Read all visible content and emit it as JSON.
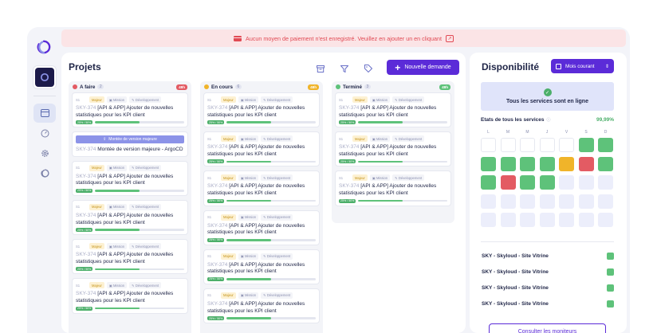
{
  "alert": {
    "text": "Aucun moyen de paiement n'est enregistré. Veuillez en ajouter un en cliquant"
  },
  "projects": {
    "title": "Projets",
    "new_button": "Nouvelle demande",
    "columns": [
      {
        "name": "A faire",
        "count": "2",
        "tag": "48h",
        "tag_color": "#e35b63",
        "icon_color": "#e35b63"
      },
      {
        "name": "En cours",
        "count": "6",
        "tag": "48h",
        "tag_color": "#f0b42a",
        "icon_color": "#f0b42a"
      },
      {
        "name": "Terminé",
        "count": "3",
        "tag": "48h",
        "tag_color": "#5ec27a",
        "icon_color": "#5ec27a"
      }
    ],
    "card": {
      "priority": "S1",
      "chip_major": "Majeur",
      "chip_mission": "Mission",
      "chip_dev": "Développement",
      "ref": "SKY-374",
      "title": "[API & APP] Ajouter de nouvelles statistiques pour les KPI client",
      "progress_label": "25% / 50%",
      "progress": 0.5
    },
    "version_card": {
      "button": "Montée de version majeure",
      "ref": "SKY-374",
      "title": "Montée de version majeure - ArgoCD"
    }
  },
  "availability": {
    "title": "Disponibilité",
    "month_button": "Mois courant",
    "status": "Tous les services sont en ligne",
    "states_label": "Etats de tous les services",
    "uptime": "99,99%",
    "days": [
      "L",
      "M",
      "M",
      "J",
      "V",
      "S",
      "D"
    ],
    "calendar": [
      "e",
      "e",
      "e",
      "e",
      "e",
      "g",
      "g",
      "g",
      "g",
      "g",
      "g",
      "y",
      "r",
      "g",
      "g",
      "r",
      "g",
      "g",
      "n",
      "n",
      "n",
      "n",
      "n",
      "n",
      "n",
      "n",
      "n",
      "n",
      "n",
      "n",
      "n",
      "n",
      "n",
      "n",
      "n"
    ],
    "services": [
      "SKY - Skyloud - Site Vitrine",
      "SKY - Skyloud - Site Vitrine",
      "SKY - Skyloud - Site Vitrine",
      "SKY - Skyloud - Site Vitrine"
    ],
    "monitor_button": "Consulter les moniteurs"
  },
  "colors": {
    "accent": "#5b2bd8",
    "success": "#5ec27a",
    "danger": "#e35b63",
    "warning": "#f0b42a"
  }
}
